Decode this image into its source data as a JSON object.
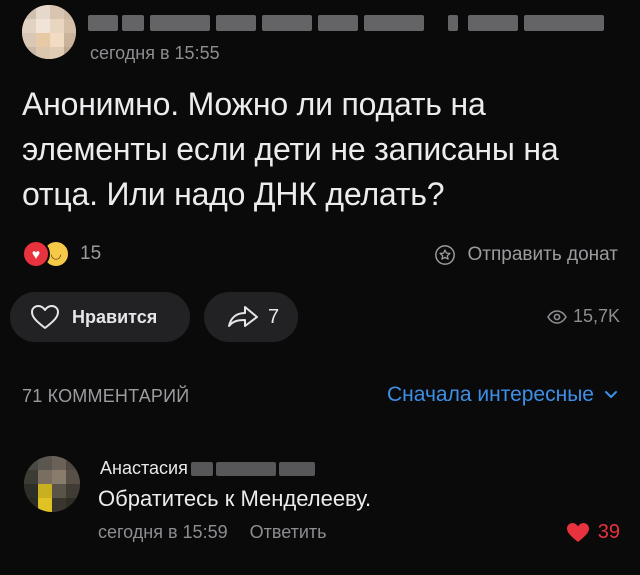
{
  "post": {
    "time": "сегодня в 15:55",
    "text": "Анонимно. Можно ли подать на элементы если дети не записаны на отца. Или надо ДНК делать?",
    "reactions_count": "15",
    "donate_label": "Отправить донат",
    "like_label": "Нравится",
    "share_count": "7",
    "views": "15,7K"
  },
  "comments": {
    "count_label": "71 КОММЕНТАРИЙ",
    "sort_label": "Сначала интересные",
    "items": [
      {
        "author": "Анастасия",
        "text": "Обратитесь к Менделееву.",
        "time": "сегодня в 15:59",
        "reply_label": "Ответить",
        "likes": "39"
      }
    ]
  },
  "colors": {
    "accent": "#3d8fe8",
    "like": "#e8323d",
    "background": "#0a0a0a",
    "button_bg": "#222225"
  },
  "icons": {
    "reaction_1": "heart-reaction-icon",
    "reaction_2": "laughing-emoji-icon",
    "donate": "donate-icon",
    "like": "heart-outline-icon",
    "share": "share-arrow-icon",
    "views": "eye-icon",
    "sort": "chevron-down-icon",
    "comment_like": "heart-filled-icon"
  }
}
